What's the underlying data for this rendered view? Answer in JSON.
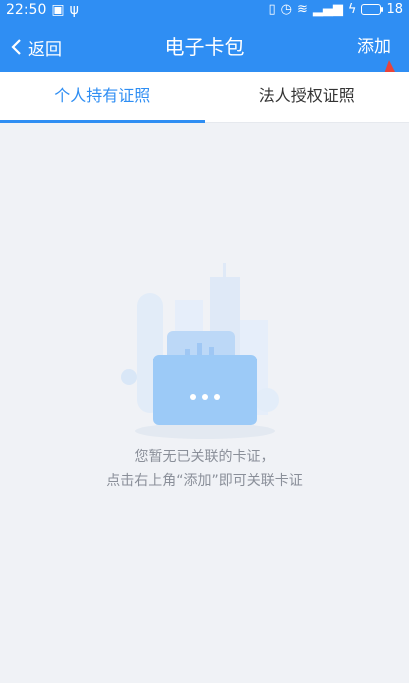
{
  "status": {
    "time": "22:50",
    "battery": "18"
  },
  "nav": {
    "back_label": "返回",
    "title": "电子卡包",
    "add_label": "添加"
  },
  "tabs": [
    {
      "label": "个人持有证照"
    },
    {
      "label": "法人授权证照"
    }
  ],
  "empty": {
    "line1": "您暂无已关联的卡证，",
    "line2": "点击右上角“添加”即可关联卡证"
  },
  "colors": {
    "accent": "#2f8ef3",
    "background": "#f0f2f6",
    "annotation_arrow": "#e8433a"
  }
}
